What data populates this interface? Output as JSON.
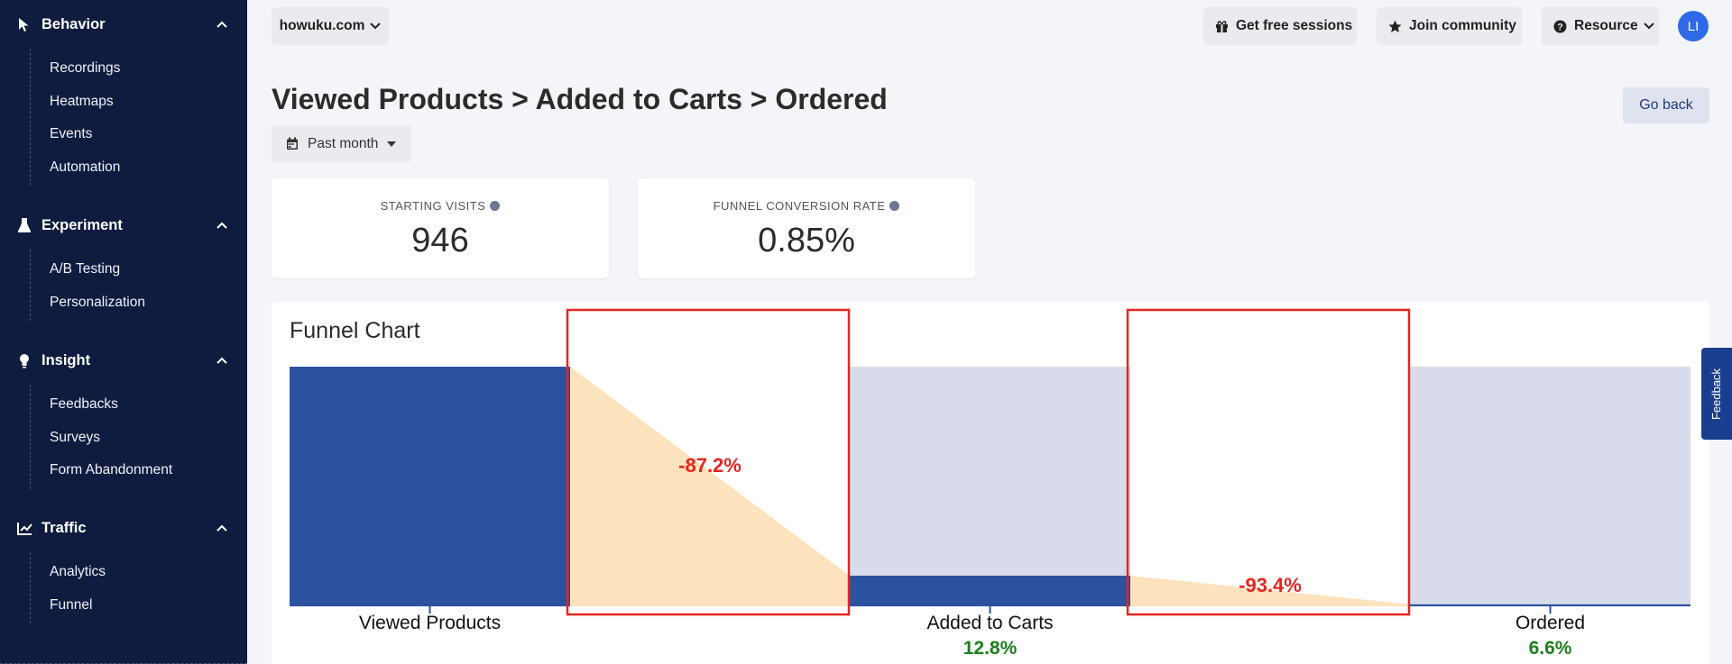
{
  "sidebar": {
    "sections": [
      {
        "label": "Behavior",
        "icon": "cursor-icon",
        "items": [
          "Recordings",
          "Heatmaps",
          "Events",
          "Automation"
        ]
      },
      {
        "label": "Experiment",
        "icon": "flask-icon",
        "items": [
          "A/B Testing",
          "Personalization"
        ]
      },
      {
        "label": "Insight",
        "icon": "lightbulb-icon",
        "items": [
          "Feedbacks",
          "Surveys",
          "Form Abandonment"
        ]
      },
      {
        "label": "Traffic",
        "icon": "chart-line-icon",
        "items": [
          "Analytics",
          "Funnel"
        ]
      }
    ]
  },
  "topbar": {
    "domain": "howuku.com",
    "get_free_sessions": "Get free sessions",
    "join_community": "Join community",
    "resource": "Resource",
    "avatar": "LI"
  },
  "page": {
    "title": "Viewed Products > Added to Carts > Ordered",
    "go_back": "Go back",
    "period": "Past month"
  },
  "stats": {
    "starting_visits_label": "STARTING VISITS",
    "starting_visits_value": "946",
    "conversion_label": "FUNNEL CONVERSION RATE",
    "conversion_value": "0.85%"
  },
  "feedback_tab": "Feedback",
  "colors": {
    "sidebar_bg": "#0f1c3f",
    "bar_fill": "#2c519e",
    "bar_bg": "#d8dcea",
    "dropoff": "#fde3bd",
    "dropoff_text": "#e8231f",
    "conversion_text": "#1d7d1d",
    "highlight_box": "#e8231f"
  },
  "chart_data": {
    "type": "bar",
    "title": "Funnel Chart",
    "categories": [
      "Viewed Products",
      "Added to Carts",
      "Ordered"
    ],
    "values": [
      946,
      121,
      8
    ],
    "conversion_labels": [
      "",
      "12.8%",
      "6.6%"
    ],
    "dropoff_labels": [
      "-87.2%",
      "-93.4%"
    ]
  }
}
